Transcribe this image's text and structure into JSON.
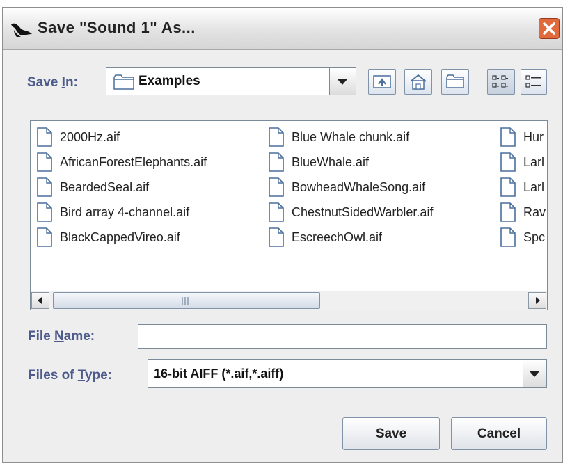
{
  "window": {
    "title": "Save \"Sound 1\" As...",
    "icon": "whale-tail-icon",
    "close_icon": "close-icon"
  },
  "save_in": {
    "label": "Save In:",
    "mnemonic": "I",
    "value": "Examples",
    "icon": "folder-icon"
  },
  "toolbar": {
    "buttons": [
      {
        "name": "up-one-level-button",
        "icon": "folder-up-icon"
      },
      {
        "name": "home-button",
        "icon": "home-icon"
      },
      {
        "name": "new-folder-button",
        "icon": "new-folder-icon"
      },
      {
        "name": "list-view-button",
        "icon": "list-view-icon",
        "selected": true
      },
      {
        "name": "details-view-button",
        "icon": "details-view-icon"
      }
    ]
  },
  "files": {
    "columns": [
      [
        "2000Hz.aif",
        "AfricanForestElephants.aif",
        "BeardedSeal.aif",
        "Bird array 4-channel.aif",
        "BlackCappedVireo.aif"
      ],
      [
        "Blue Whale chunk.aif",
        "BlueWhale.aif",
        "BowheadWhaleSong.aif",
        "ChestnutSidedWarbler.aif",
        "EscreechOwl.aif"
      ],
      [
        "Hur",
        "Larl",
        "Larl",
        "Rav",
        "Spc"
      ]
    ],
    "file_icon": "document-icon"
  },
  "scrollbar": {
    "left_icon": "arrow-left-icon",
    "right_icon": "arrow-right-icon",
    "grip_icon": "grip-icon"
  },
  "file_name": {
    "label": "File Name:",
    "mnemonic": "N",
    "value": ""
  },
  "file_type": {
    "label": "Files of Type:",
    "mnemonic": "T",
    "value": "16-bit AIFF (*.aif,*.aiff)"
  },
  "buttons": {
    "save": "Save",
    "cancel": "Cancel"
  },
  "colors": {
    "label": "#4d5b8c",
    "close_button": "#e06a3c",
    "icon_stroke": "#4a6f9c"
  }
}
